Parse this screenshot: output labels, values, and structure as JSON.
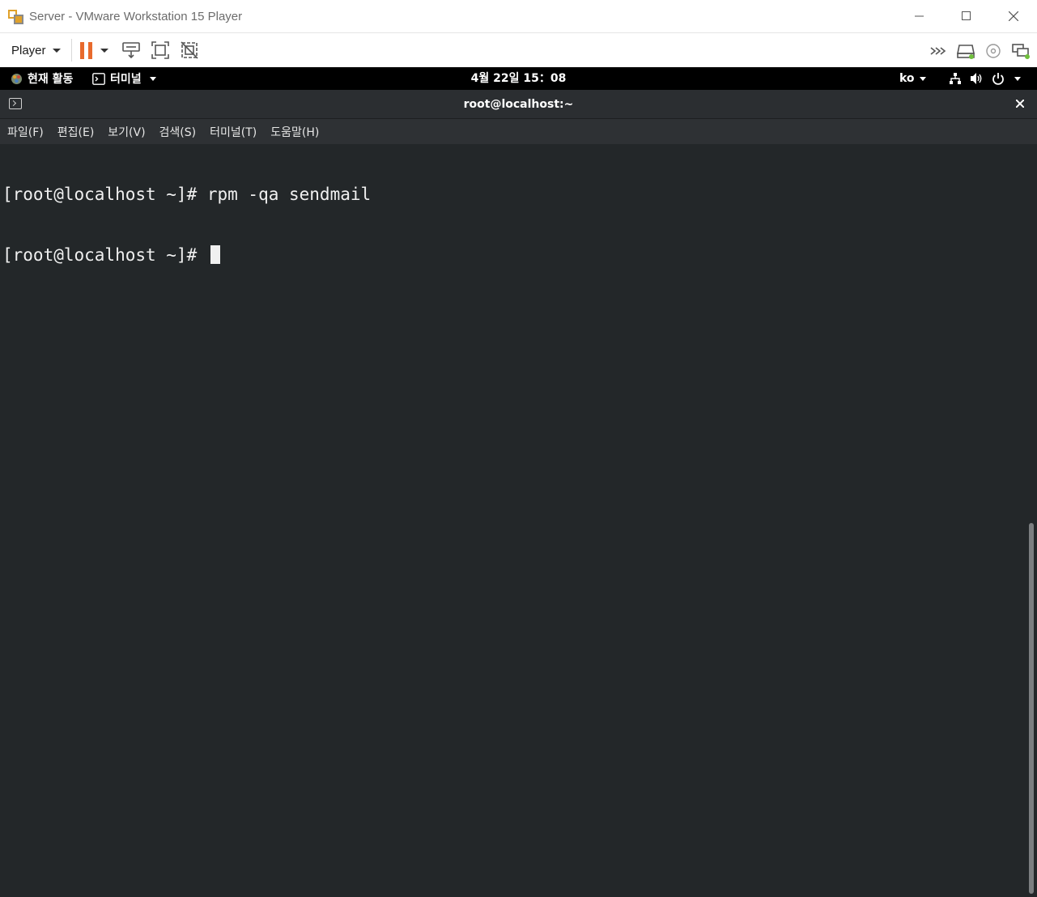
{
  "window": {
    "title": "Server - VMware Workstation 15 Player",
    "controls": [
      "minimize-icon",
      "maximize-icon",
      "close-icon"
    ]
  },
  "player_toolbar": {
    "player_label": "Player",
    "left_icons": [
      "pause-icon",
      "dropdown-icon",
      "send-ctrl-alt-del-icon",
      "fullscreen-icon",
      "unity-icon"
    ],
    "right_icons": [
      "more-icon",
      "hard-disk-icon",
      "cd-dvd-icon",
      "network-adapter-icon"
    ]
  },
  "gnome_bar": {
    "activities": "현재 활동",
    "app_menu": "터미널",
    "clock": "4월 22일  15：08",
    "language": "ko"
  },
  "terminal": {
    "title": "root@localhost:~",
    "menu": [
      "파일(F)",
      "편집(E)",
      "보기(V)",
      "검색(S)",
      "터미널(T)",
      "도움말(H)"
    ],
    "lines": [
      "[root@localhost ~]# rpm -qa sendmail",
      "[root@localhost ~]# "
    ],
    "colors": {
      "background": "#232729",
      "foreground": "#f0f0f0",
      "pause_accent": "#e86a2d"
    }
  }
}
